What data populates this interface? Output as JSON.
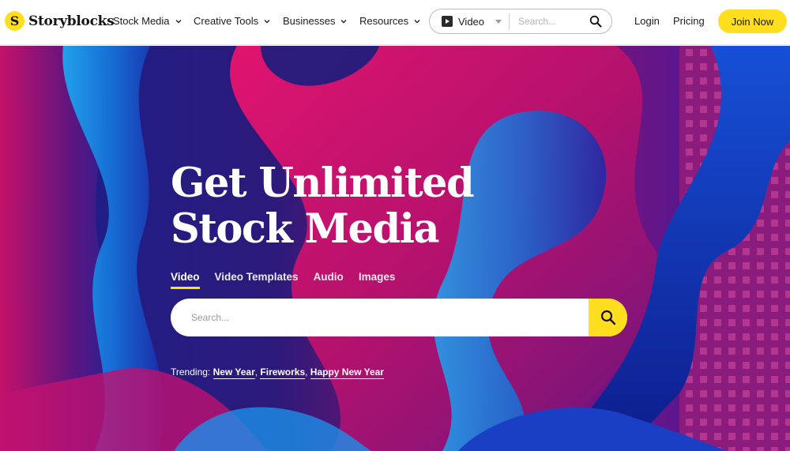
{
  "brand": {
    "logo_glyph": "S",
    "name": "Storyblocks",
    "accent_color": "#ffde1f"
  },
  "nav": {
    "menu": [
      {
        "label": "Stock Media",
        "icon": "chevron-down-icon"
      },
      {
        "label": "Creative Tools",
        "icon": "chevron-down-icon"
      },
      {
        "label": "Businesses",
        "icon": "chevron-down-icon"
      },
      {
        "label": "Resources",
        "icon": "chevron-down-icon"
      }
    ],
    "search": {
      "type_icon": "play-icon",
      "type_selected": "Video",
      "placeholder": "Search...",
      "icon": "search-icon"
    },
    "login_label": "Login",
    "pricing_label": "Pricing",
    "join_label": "Join Now"
  },
  "hero": {
    "headline_line1": "Get Unlimited",
    "headline_line2": "Stock Media",
    "tabs": [
      {
        "label": "Video",
        "active": true
      },
      {
        "label": "Video Templates",
        "active": false
      },
      {
        "label": "Audio",
        "active": false
      },
      {
        "label": "Images",
        "active": false
      }
    ],
    "search": {
      "placeholder": "Search...",
      "icon": "search-icon"
    },
    "trending": {
      "label": "Trending:",
      "items": [
        "New Year",
        "Fireworks",
        "Happy New Year"
      ]
    }
  }
}
